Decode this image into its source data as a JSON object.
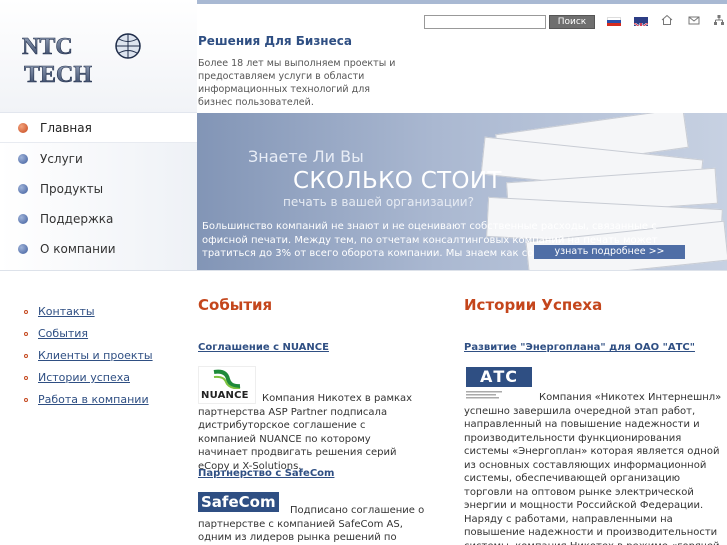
{
  "header": {
    "logo_alt": "NTC TECH",
    "tagline_title": "Решения Для Бизнеса",
    "tagline_text": "Более 18 лет мы выполняем проекты и предоставляем услуги в области информационных технологий для бизнес пользователей.",
    "search_placeholder": "",
    "search_button": "Поиск",
    "icons": [
      "flag-ru-icon",
      "flag-gb-icon",
      "home-icon",
      "mail-icon",
      "sitemap-icon"
    ]
  },
  "nav": {
    "items": [
      {
        "label": "Главная",
        "active": true
      },
      {
        "label": "Услуги",
        "active": false
      },
      {
        "label": "Продукты",
        "active": false
      },
      {
        "label": "Поддержка",
        "active": false
      },
      {
        "label": "О компании",
        "active": false
      }
    ]
  },
  "banner": {
    "line1": "Знаете Ли Вы",
    "line2": "СКОЛЬКО СТОИТ",
    "line3": "печать в вашей организации?",
    "text": "Большинство компаний не знают и не оценивают собственные расходы, связанные с офисной печати. Между тем, по отчетам консалтинговых компаний на печать может тратиться до 3% от всего оборота компании. Мы знаем как сократить эти расходы.",
    "button": "узнать подробнее >>"
  },
  "sub_links": [
    "Контакты",
    "События",
    "Клиенты и проекты",
    "Истории успеха",
    "Работа в компании"
  ],
  "events": {
    "heading": "События",
    "items": [
      {
        "title": "Соглашение с NUANCE",
        "logo_text": "NUANCE",
        "text": "Компания Никотех в рамках партнерства ASP Partner подписала дистрибуторское соглашение с компанией NUANCE по которому начинает продвигать решения серий eCopy и X-Solutions."
      },
      {
        "title": "Партнерство с SafeCom",
        "logo_text": "SafeCom",
        "text": "Подписано соглашение о партнерстве с компанией SafeCom AS, одним из лидеров рынка решений по управлению"
      }
    ]
  },
  "success": {
    "heading": "Истории Успеха",
    "items": [
      {
        "title": "Развитие \"Энергоплана\" для ОАО \"АТС\"",
        "logo_text": "АТС",
        "text": "Компания «Никотех Интернешнл» успешно завершила очередной этап работ, направленный на повышение надежности и производительности функционирования системы «Энергоплан» которая является одной из основных составляющих информационной системы, обеспечивающей организацию торговли на оптовом рынке электрической энергии и мощности Российской Федерации. Наряду с работами, направленными на повышение надежности и производительности системы, компания Никотех в режиме «горячей линии»"
      }
    ]
  },
  "colors": {
    "accent_red": "#c4461c",
    "link_blue": "#2f4f83",
    "banner_blue": "#8295b6"
  }
}
